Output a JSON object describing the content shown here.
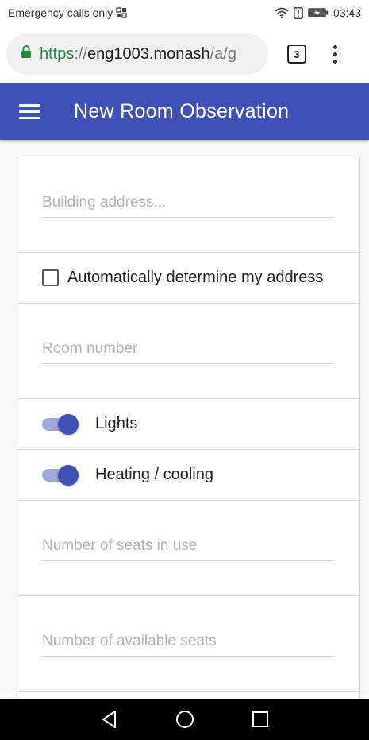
{
  "status_bar": {
    "carrier_text": "Emergency calls only",
    "time": "03:43",
    "icons": [
      "sim-icon",
      "wifi-icon",
      "alert-icon",
      "battery-charging-icon"
    ]
  },
  "browser": {
    "url_scheme": "https",
    "url_separator": "://",
    "url_host": "eng1003.monash",
    "url_path": "/a/g",
    "tab_count": "3",
    "icons": [
      "lock-icon",
      "tab-switcher-icon",
      "overflow-menu-icon"
    ]
  },
  "app_bar": {
    "title": "New Room Observation",
    "icon": "menu-icon",
    "color": "#3f51b5"
  },
  "form": {
    "building_address_placeholder": "Building address...",
    "auto_address_label": "Automatically determine my address",
    "auto_address_checked": false,
    "room_number_placeholder": "Room number",
    "lights_label": "Lights",
    "lights_on": true,
    "heating_label": "Heating / cooling",
    "heating_on": true,
    "seats_in_use_placeholder": "Number of seats in use",
    "available_seats_placeholder": "Number of available seats"
  },
  "nav_bar": {
    "icons": [
      "back-icon",
      "home-icon",
      "recents-icon"
    ]
  },
  "colors": {
    "accent": "#3f51b5",
    "switch_track": "#9fa8da",
    "secure_green": "#1e8e3e"
  }
}
